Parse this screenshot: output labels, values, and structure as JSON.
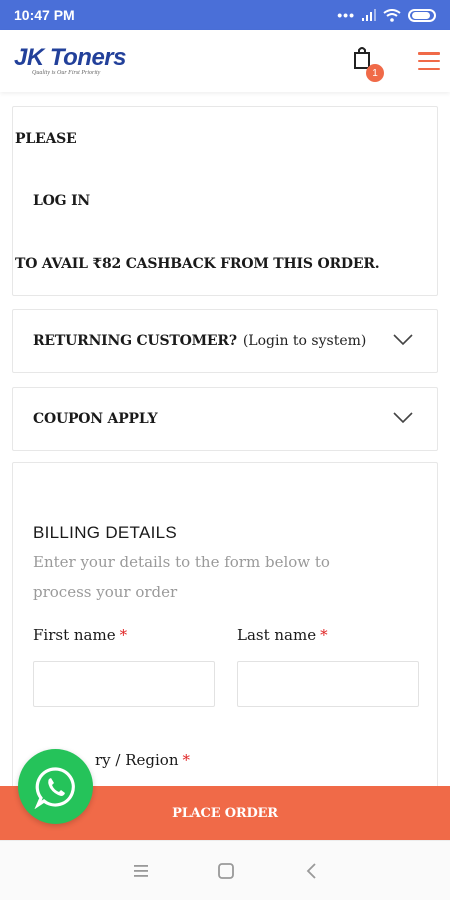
{
  "status_bar": {
    "time": "10:47 PM"
  },
  "header": {
    "logo_text": "JK Toners",
    "logo_tagline": "Quality is Our First Priority",
    "cart_count": "1"
  },
  "login_prompt": {
    "line1": "PLEASE",
    "line2": "LOG IN",
    "line3": "TO AVAIL ₹82 CASHBACK FROM THIS ORDER."
  },
  "returning_customer": {
    "title": "RETURNING CUSTOMER?",
    "subtitle": "(Login to system)"
  },
  "coupon": {
    "title": "COUPON APPLY"
  },
  "billing": {
    "title": "BILLING DETAILS",
    "description": "Enter your details to the form below to process your order",
    "first_name_label": "First name",
    "last_name_label": "Last name",
    "required_mark": "*",
    "country_label_visible": "ry / Region",
    "first_name_value": "",
    "last_name_value": ""
  },
  "place_order_label": "PLACE ORDER",
  "colors": {
    "accent": "#f06a48",
    "status_bar": "#4a6fd8",
    "brand": "#22409a",
    "whatsapp": "#25c35a"
  },
  "icons": [
    "cart-icon",
    "menu-icon",
    "chevron-down-icon",
    "whatsapp-icon",
    "nav-recents-icon",
    "nav-home-icon",
    "nav-back-icon"
  ]
}
